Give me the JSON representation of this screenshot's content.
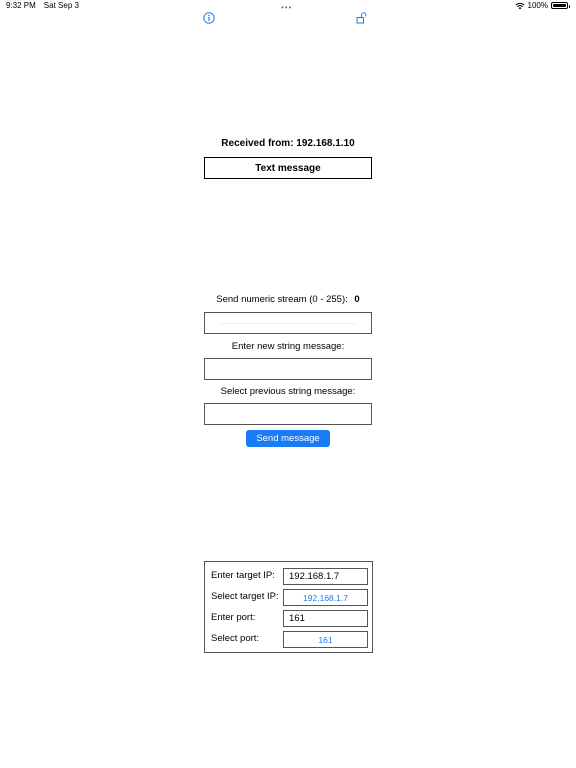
{
  "status_bar": {
    "time": "9:32 PM",
    "date": "Sat Sep 3",
    "battery": "100%"
  },
  "icons": {
    "info": "info-icon",
    "lock": "unlock-icon",
    "wifi": "wifi-icon",
    "battery": "battery-icon",
    "multitasking": "multitasking-dots-icon"
  },
  "received": {
    "label": "Received from: 192.168.1.10",
    "message": "Text message"
  },
  "send": {
    "numeric_label": "Send numeric stream (0 - 255):",
    "numeric_value": "0",
    "new_string_label": "Enter new string message:",
    "new_string_value": "",
    "previous_string_label": "Select previous string message:",
    "previous_string_value": "",
    "button_label": "Send message"
  },
  "config": {
    "target_ip_label": "Enter target IP:",
    "target_ip_value": "192.168.1.7",
    "select_target_ip_label": "Select target IP:",
    "select_target_ip_value": "192.168.1.7",
    "port_label": "Enter port:",
    "port_value": "161",
    "select_port_label": "Select port:",
    "select_port_value": "161"
  },
  "colors": {
    "accent": "#1a7cf5",
    "border": "#555555"
  }
}
